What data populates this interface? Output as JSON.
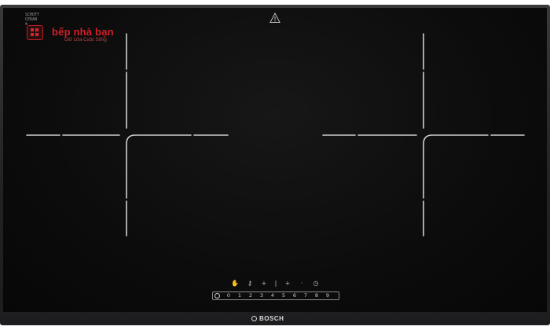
{
  "hob": {
    "certification_text": [
      "SCHOTT",
      "CERAN",
      "®"
    ],
    "brand": {
      "name": "bếp nhà bạn",
      "tagline": "Giữ Lửa Cuộc Sống",
      "color": "#d31f27"
    },
    "manufacturer": "BOSCH",
    "controls": {
      "function_icons": [
        {
          "icon": "hand-icon",
          "glyph": "✋"
        },
        {
          "icon": "key-icon",
          "glyph": "⚷"
        },
        {
          "icon": "plus-icon",
          "glyph": "+"
        },
        {
          "icon": "zone-divider-icon",
          "glyph": "|"
        },
        {
          "icon": "plus-icon",
          "glyph": "+"
        },
        {
          "icon": "dot-icon",
          "glyph": "·"
        },
        {
          "icon": "timer-icon",
          "glyph": "◷"
        }
      ],
      "power_levels": [
        "0",
        "1",
        "2",
        "3",
        "4",
        "5",
        "6",
        "7",
        "8",
        "9"
      ]
    },
    "colors": {
      "glass": "#0c0c0c",
      "frame": "#2a2a2c",
      "markings": "#d8d8d8"
    }
  }
}
